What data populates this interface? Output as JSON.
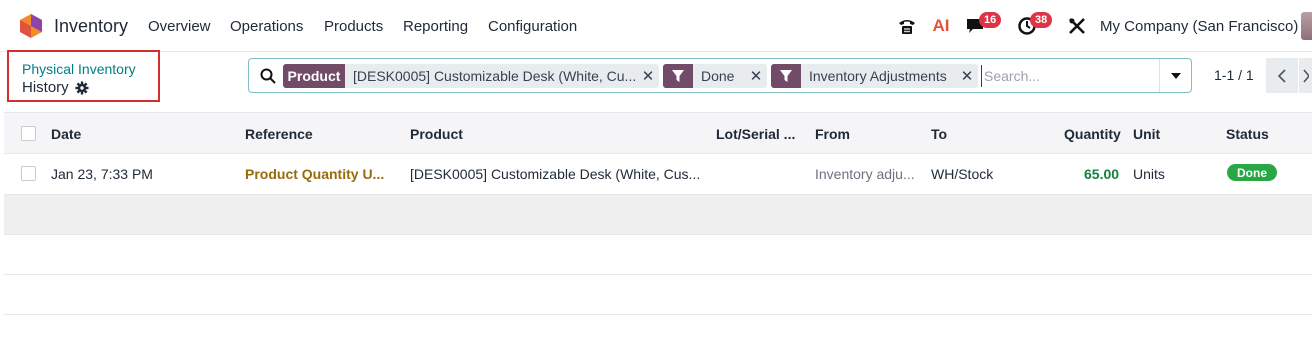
{
  "navbar": {
    "app_name": "Inventory",
    "menu": [
      "Overview",
      "Operations",
      "Products",
      "Reporting",
      "Configuration"
    ],
    "ai_label": "AI",
    "messages_count": "16",
    "activities_count": "38",
    "company": "My Company (San Francisco)"
  },
  "breadcrumb": {
    "parent": "Physical Inventory",
    "current": "History"
  },
  "search": {
    "facets": [
      {
        "type": "Product",
        "value": "[DESK0005] Customizable Desk (White, Cu..."
      },
      {
        "type": "filter-icon",
        "value": "Done"
      },
      {
        "type": "filter-icon",
        "value": "Inventory Adjustments"
      }
    ],
    "placeholder": "Search..."
  },
  "pager": {
    "value": "1-1 / 1"
  },
  "table": {
    "columns": [
      "Date",
      "Reference",
      "Product",
      "Lot/Serial ...",
      "From",
      "To",
      "Quantity",
      "Unit",
      "Status"
    ],
    "rows": [
      {
        "date": "Jan 23, 7:33 PM",
        "reference": "Product Quantity U...",
        "product": "[DESK0005] Customizable Desk (White, Cus...",
        "lot": "",
        "from": "Inventory adju...",
        "to": "WH/Stock",
        "quantity": "65.00",
        "unit": "Units",
        "status": "Done"
      }
    ]
  },
  "colors": {
    "brand": "#714b67",
    "accent": "#017e84",
    "reference": "#9a6a0b",
    "quantity": "#15803d",
    "status_done": "#28a745",
    "badge": "#dc3545",
    "highlight_border": "#d32f2f"
  }
}
